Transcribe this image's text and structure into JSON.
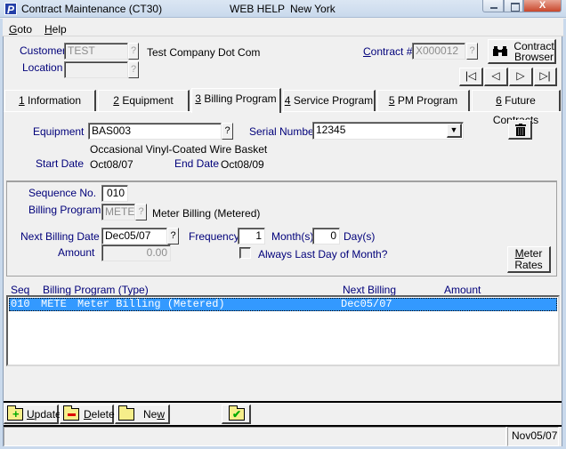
{
  "window": {
    "app_icon_letter": "P",
    "title": "Contract Maintenance (CT30)",
    "subtitle_1": "WEB HELP",
    "subtitle_2": "New York",
    "close_glyph": "X"
  },
  "menu": [
    {
      "label": "Goto",
      "accel": "G",
      "rest": "oto"
    },
    {
      "label": "Help",
      "accel": "H",
      "rest": "elp"
    }
  ],
  "header": {
    "customer_label": "Customer",
    "customer_value": "TEST",
    "customer_name": "Test Company Dot Com",
    "location_label": "Location",
    "location_value": "",
    "contract_label_accel": "C",
    "contract_label_rest": "ontract #",
    "contract_value": "X000012",
    "lookup_glyph": "?",
    "contract_browser_line1": "Contract",
    "contract_browser_line2": "Browser",
    "nav": {
      "first": "|◁",
      "prev": "◁",
      "next": "▷",
      "last": "▷|"
    }
  },
  "tabs": [
    {
      "accel": "1",
      "label": " Information",
      "active": false
    },
    {
      "accel": "2",
      "label": " Equipment",
      "active": false
    },
    {
      "accel": "3",
      "label": " Billing Program",
      "active": true
    },
    {
      "accel": "4",
      "label": " Service Program",
      "active": false
    },
    {
      "accel": "5",
      "label": " PM Program",
      "active": false
    },
    {
      "accel": "6",
      "label": " Future Contracts",
      "active": false
    }
  ],
  "equipment": {
    "equipment_label": "Equipment",
    "equipment_value": "BAS003",
    "description": "Occasional Vinyl-Coated Wire Basket",
    "serial_label": "Serial Number",
    "serial_value": "12345",
    "start_date_label": "Start Date",
    "start_date_value": "Oct08/07",
    "end_date_label": "End Date",
    "end_date_value": "Oct08/09"
  },
  "billing": {
    "sequence_label": "Sequence No.",
    "sequence_value": "010",
    "program_label": "Billing Program",
    "program_code": "METE",
    "program_desc": "Meter Billing (Metered)",
    "next_billing_label": "Next Billing Date",
    "next_billing_value": "Dec05/07",
    "frequency_label": "Frequency",
    "frequency_months": "1",
    "months_label": "Month(s)",
    "frequency_days": "0",
    "days_label": "Day(s)",
    "amount_label": "Amount",
    "amount_value": "0.00",
    "always_last_day_label": "Always Last Day of Month?",
    "always_last_day_checked": false,
    "meter_rates_accel": "M",
    "meter_rates_rest": "eter",
    "meter_rates_line2": "Rates"
  },
  "list": {
    "columns": [
      "Seq",
      "Billing Program (Type)",
      "Next Billing",
      "Amount"
    ],
    "rows": [
      {
        "seq": "010",
        "code": "METE",
        "desc": "Meter Billing (Metered)",
        "next_billing": "Dec05/07",
        "amount": "",
        "selected": true
      }
    ]
  },
  "toolbar": {
    "update_accel": "U",
    "update_rest": "pdate",
    "delete_accel": "D",
    "delete_rest": "elete",
    "new_pre": "Ne",
    "new_accel": "w"
  },
  "status": {
    "message": "",
    "date": "Nov05/07"
  },
  "colors": {
    "selection": "#3399ff",
    "label_blue": "#00007a"
  }
}
